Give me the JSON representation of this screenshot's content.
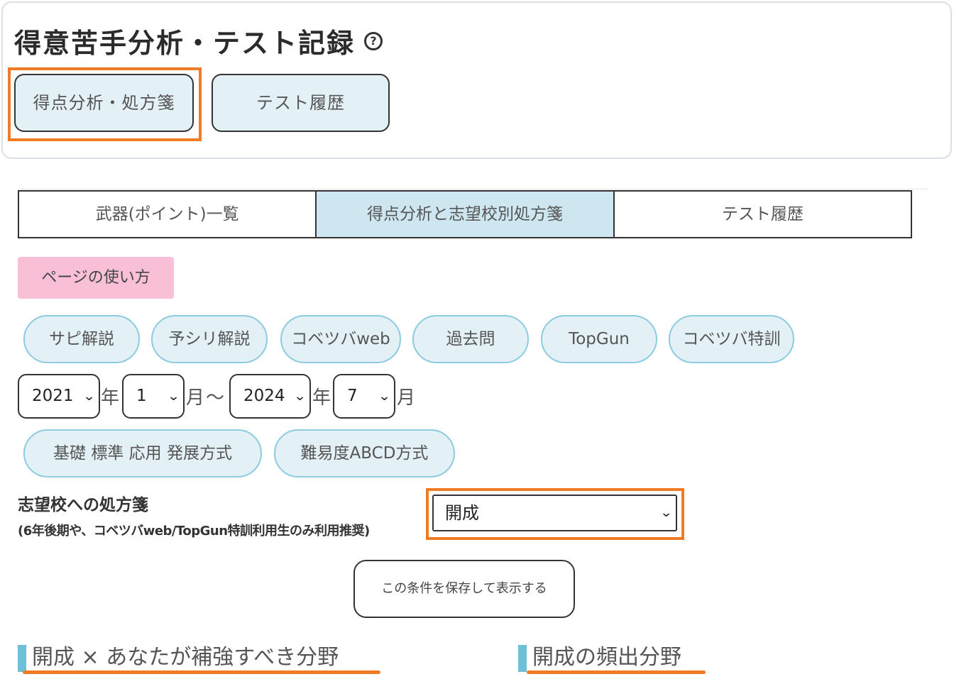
{
  "header": {
    "title": "得意苦手分析・テスト記録",
    "help_icon_label": "?",
    "buttons": {
      "score_analysis": "得点分析・処方箋",
      "test_history": "テスト履歴"
    }
  },
  "tabs": [
    {
      "label": "武器(ポイント)一覧",
      "active": false
    },
    {
      "label": "得点分析と志望校別処方箋",
      "active": true
    },
    {
      "label": "テスト履歴",
      "active": false
    }
  ],
  "howto_label": "ページの使い方",
  "filters": [
    "サピ解説",
    "予シリ解説",
    "コベツバweb",
    "過去問",
    "TopGun",
    "コベツバ特訓"
  ],
  "date_range": {
    "start_year": "2021",
    "start_month": "1",
    "end_year": "2024",
    "end_month": "7",
    "year_unit": "年",
    "month_unit": "月",
    "tilde": "～"
  },
  "methods": {
    "basic": "基礎 標準 応用 発展方式",
    "abcd": "難易度ABCD方式"
  },
  "prescription": {
    "label": "志望校への処方箋",
    "note": "(6年後期や、コベツバweb/TopGun特訓利用生のみ利用推奨)",
    "selected_school": "開成"
  },
  "save_label": "この条件を保存して表示する",
  "sections": {
    "weak_fields": "開成 × あなたが補強すべき分野",
    "frequent_fields": "開成の頻出分野"
  },
  "colors": {
    "highlight": "#f07b24",
    "pill_bg": "#e3f1f6",
    "pill_border": "#8ccbe0",
    "active_tab": "#cde6ef",
    "howto_bg": "#f9bfd6",
    "section_bar": "#6fbfd9"
  }
}
